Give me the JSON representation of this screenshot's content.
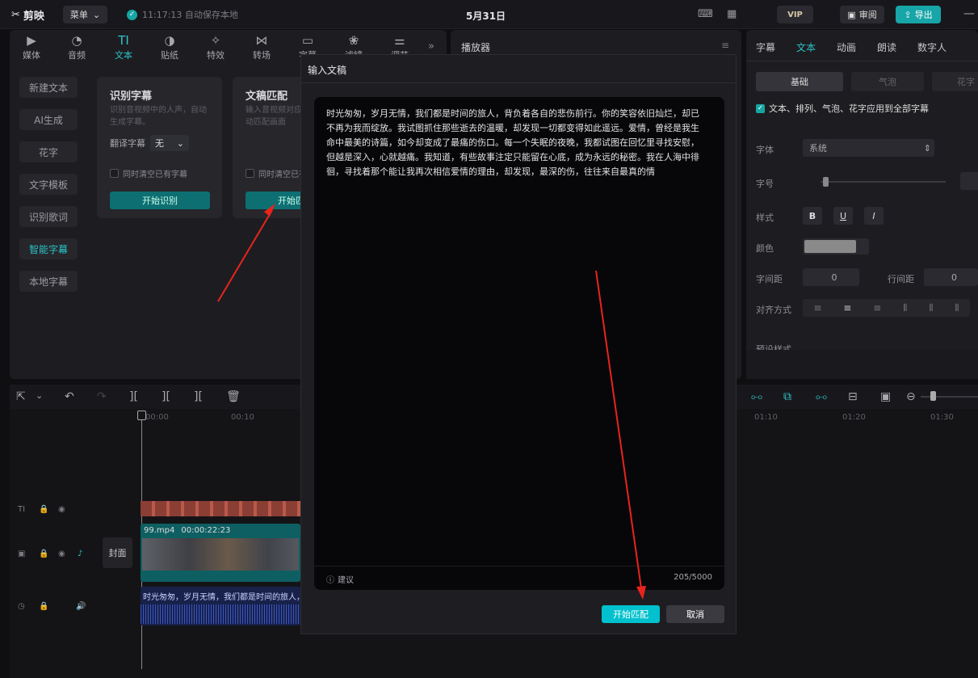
{
  "app": {
    "name": "剪映",
    "menu_label": "菜单",
    "autosave": "11:17:13 自动保存本地",
    "project_title": "5月31日"
  },
  "top_right": {
    "vip": "VIP",
    "review": "审阅",
    "export": "导出"
  },
  "toolbar": [
    "媒体",
    "音频",
    "文本",
    "贴纸",
    "特效",
    "转场",
    "字幕",
    "滤镜",
    "调节"
  ],
  "side_nav": [
    "新建文本",
    "AI生成",
    "花字",
    "文字模板",
    "识别歌词",
    "智能字幕",
    "本地字幕"
  ],
  "cards": {
    "recognize": {
      "title": "识别字幕",
      "desc": "识别音视频中的人声，自动生成字幕。",
      "translate_label": "翻译字幕",
      "translate_value": "无",
      "clear_label": "同时清空已有字幕",
      "button": "开始识别"
    },
    "match": {
      "title": "文稿匹配",
      "desc": "输入音视频对应的文稿，自动匹配画面",
      "clear_label": "同时清空已有字幕",
      "button": "开始匹配"
    }
  },
  "player": {
    "title": "播放器"
  },
  "right_panel": {
    "tabs": [
      "字幕",
      "文本",
      "动画",
      "朗读",
      "数字人"
    ],
    "subtabs": [
      "基础",
      "气泡",
      "花字"
    ],
    "apply_all": "文本、排列、气泡、花字应用到全部字幕",
    "font_label": "字体",
    "font_value": "系统",
    "size_label": "字号",
    "style_label": "样式",
    "color_label": "颜色",
    "letter_spacing_label": "字间距",
    "letter_spacing_value": "0",
    "line_spacing_label": "行间距",
    "line_spacing_value": "0",
    "align_label": "对齐方式",
    "preset_label": "预设样式"
  },
  "timeline": {
    "ruler_left": [
      "00:00",
      "00:10"
    ],
    "ruler_right": [
      "01:10",
      "01:20",
      "01:30"
    ],
    "cover_label": "封面",
    "clip_name": "99.mp4",
    "clip_duration": "00:00:22:23",
    "audio_caption": "时光匆匆，岁月无情，我们都是时间的旅人，"
  },
  "modal": {
    "title": "输入文稿",
    "body": "时光匆匆，岁月无情，我们都是时间的旅人，背负着各自的悲伤前行。你的笑容依旧灿烂，却已不再为我而绽放。我试图抓住那些逝去的温暖，却发现一切都变得如此遥远。爱情，曾经是我生命中最美的诗篇，如今却变成了最痛的伤口。每一个失眠的夜晚，我都试图在回忆里寻找安慰，但越是深入，心就越痛。我知道，有些故事注定只能留在心底，成为永远的秘密。我在人海中徘徊，寻找着那个能让我再次相信爱情的理由，却发现，最深的伤，往往来自最真的情",
    "tip": "建议",
    "count": "205/5000",
    "ok": "开始匹配",
    "cancel": "取消"
  },
  "colors": {
    "accent": "#00c1cd",
    "annotation": "#e8241c"
  }
}
